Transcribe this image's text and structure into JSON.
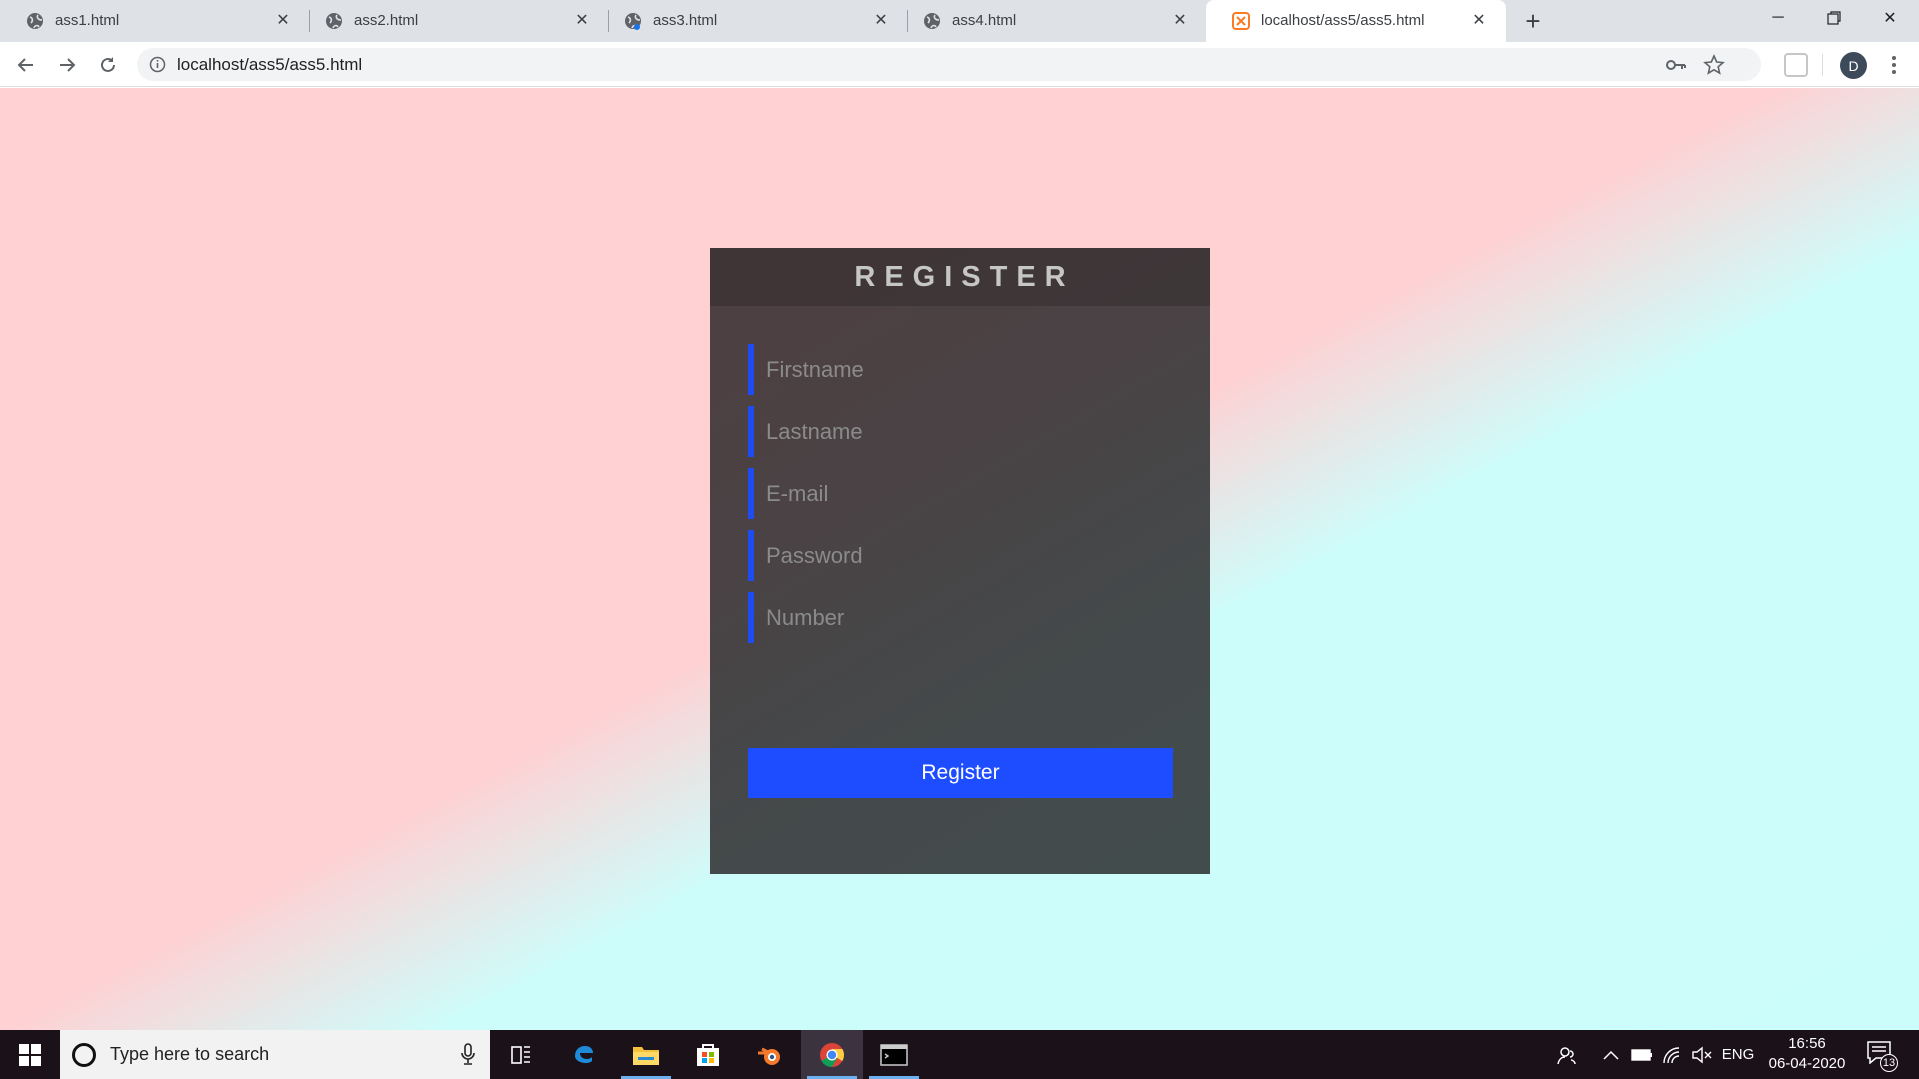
{
  "browser": {
    "tabs": [
      {
        "title": "ass1.html",
        "active": false
      },
      {
        "title": "ass2.html",
        "active": false
      },
      {
        "title": "ass3.html",
        "active": false
      },
      {
        "title": "ass4.html",
        "active": false
      },
      {
        "title": "localhost/ass5/ass5.html",
        "active": true
      }
    ],
    "url": "localhost/ass5/ass5.html",
    "profile_initial": "D"
  },
  "page": {
    "title": "REGISTER",
    "fields": {
      "firstname_placeholder": "Firstname",
      "lastname_placeholder": "Lastname",
      "email_placeholder": "E-mail",
      "password_placeholder": "Password",
      "number_placeholder": "Number"
    },
    "register_label": "Register",
    "colors": {
      "accent": "#1e4cff",
      "card": "#474546",
      "bg_left": "#ffd1d3",
      "bg_right": "#cbfdfb"
    }
  },
  "taskbar": {
    "search_placeholder": "Type here to search",
    "language": "ENG",
    "time": "16:56",
    "date": "06-04-2020",
    "notifications": "13"
  }
}
